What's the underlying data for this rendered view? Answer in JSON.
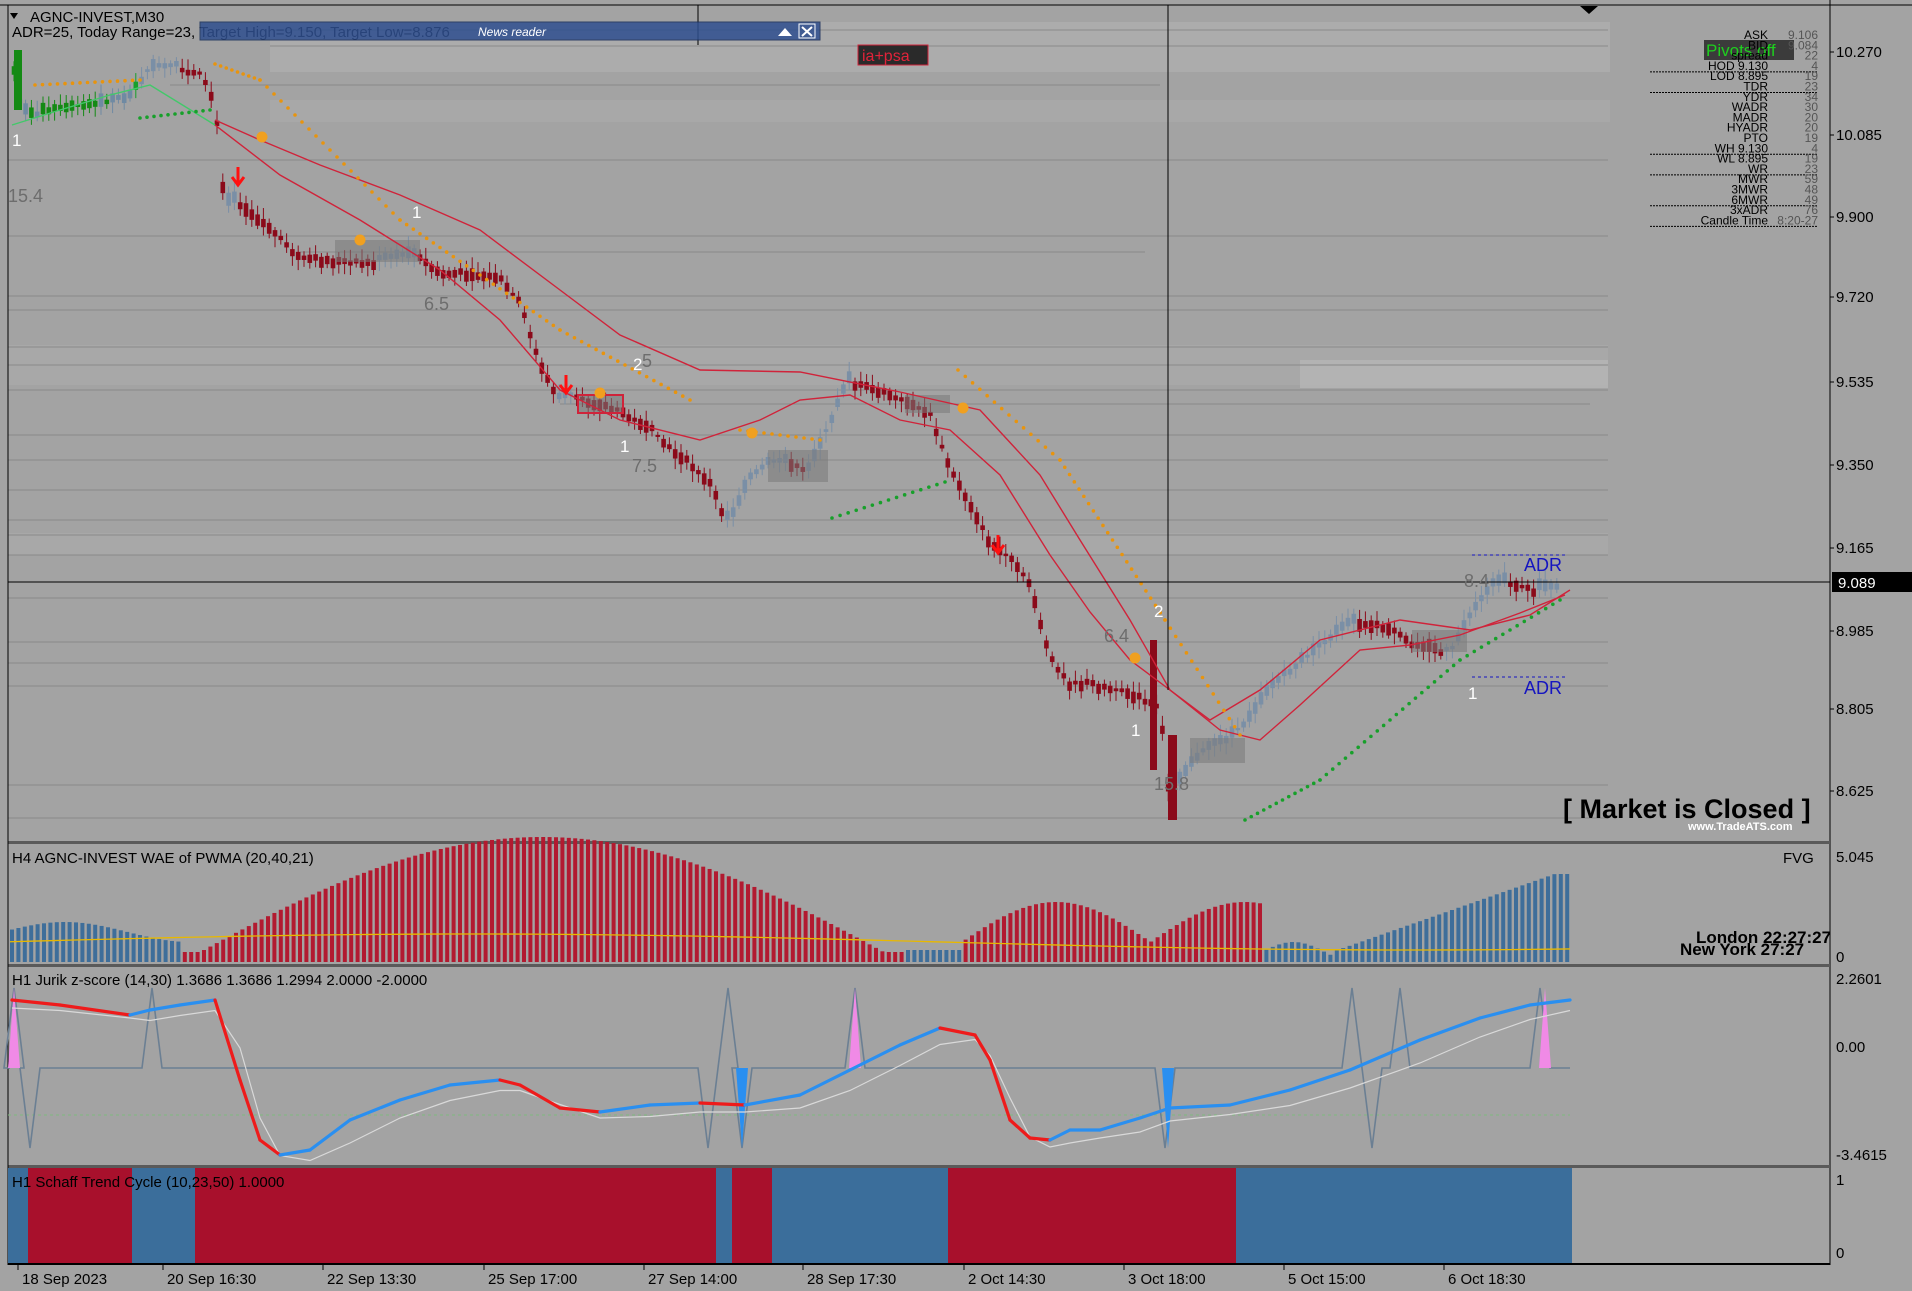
{
  "header": {
    "symbol": "AGNC-INVEST,M30",
    "adr_line": "ADR=25, Today Range=23, Target High=9.150, Target Low=8.876"
  },
  "news_reader": {
    "title": "News reader"
  },
  "badge": {
    "label": "ia+psa"
  },
  "market_closed": "[ Market is Closed ]",
  "watermark": "www.TradeATS.com",
  "current_price": "9.089",
  "price_axis": [
    "10.270",
    "10.085",
    "9.900",
    "9.720",
    "9.535",
    "9.350",
    "9.165",
    "8.985",
    "8.805",
    "8.625"
  ],
  "info_panel": {
    "pivot_label": "Pivots off",
    "rows": [
      {
        "label": "ASK",
        "value": "9.106"
      },
      {
        "label": "BID",
        "value": "9.084"
      },
      {
        "label": "spread",
        "value": "22"
      },
      {
        "label": "HOD 9.130",
        "value": "4"
      },
      {
        "label": "LOD 8.895",
        "value": "19"
      },
      {
        "label": "TDR",
        "value": "23"
      },
      {
        "label": "YDR",
        "value": "34"
      },
      {
        "label": "WADR",
        "value": "30"
      },
      {
        "label": "MADR",
        "value": "20"
      },
      {
        "label": "HYADR",
        "value": "20"
      },
      {
        "label": "PTO",
        "value": "19"
      },
      {
        "label": "WH 9.130",
        "value": "4"
      },
      {
        "label": "WL 8.895",
        "value": "19"
      },
      {
        "label": "WR",
        "value": "23"
      },
      {
        "label": "MWR",
        "value": "59"
      },
      {
        "label": "3MWR",
        "value": "48"
      },
      {
        "label": "6MWR",
        "value": "49"
      },
      {
        "label": "3xADR",
        "value": "76"
      },
      {
        "label": "Candle Time",
        "value": "8:20-27"
      }
    ]
  },
  "chart_labels": {
    "zz_1a": "1",
    "zz_15_4": "15.4",
    "zz_1b": "1",
    "zz_6_5": "6.5",
    "zz_2a": "2",
    "zz_5": "5",
    "zz_1c": "1",
    "zz_7_5": "7.5",
    "zz_6_4": "6.4",
    "zz_2b": "2",
    "zz_1d": "1",
    "zz_15_8": "15.8",
    "zz_1e": "1",
    "zz_8_4": "8.4",
    "adr_top": "ADR",
    "adr_bottom": "ADR"
  },
  "wae_panel": {
    "title": "H4 AGNC-INVEST WAE of PWMA (20,40,21)",
    "fvg": "FVG",
    "axis_top": "5.045",
    "axis_bottom": "0",
    "london": "London 22:27:27",
    "newyork": "New York 27:27"
  },
  "jurik_panel": {
    "title": "H1 Jurik z-score (14,30) 1.3686 1.3686 1.2994 2.0000 -2.0000",
    "axis_top": "2.2601",
    "axis_mid": "0.00",
    "axis_bottom": "-3.4615"
  },
  "schaff_panel": {
    "title": "H1 Schaff Trend Cycle (10,23,50) 1.0000",
    "axis_top": "1",
    "axis_bottom": "0"
  },
  "time_axis": [
    "18 Sep 2023",
    "20 Sep 16:30",
    "22 Sep 13:30",
    "25 Sep 17:00",
    "27 Sep 14:00",
    "28 Sep 17:30",
    "2 Oct 14:30",
    "3 Oct 18:00",
    "5 Oct 15:00",
    "6 Oct 18:30"
  ],
  "colors": {
    "background": "#a3a3a3",
    "bear_candle": "#8b0a1a",
    "bull_candle": "#7a8fa6",
    "ma_red": "#d0233a",
    "dots_orange": "#e8940e",
    "dots_green": "#17a02a",
    "bar_red": "#b21a30",
    "bar_blue": "#3e6e9a",
    "jurik_blue": "#2a8ff0",
    "jurik_red": "#ee1b1b",
    "schaff_red": "#a8102c",
    "schaff_blue": "#3b6e9b"
  },
  "chart_data": [
    {
      "type": "candlestick",
      "title": "AGNC-INVEST,M30",
      "x": [
        "18 Sep 2023",
        "20 Sep 16:30",
        "22 Sep 13:30",
        "25 Sep 17:00",
        "27 Sep 14:00",
        "28 Sep 17:30",
        "2 Oct 14:30",
        "3 Oct 18:00",
        "5 Oct 15:00",
        "6 Oct 18:30"
      ],
      "close": [
        10.15,
        10.15,
        9.83,
        9.47,
        9.37,
        9.5,
        9.2,
        8.65,
        8.95,
        9.089
      ],
      "ylim": [
        8.55,
        10.36
      ],
      "last_price": 9.089
    },
    {
      "type": "bar",
      "title": "H4 AGNC-INVEST WAE of PWMA (20,40,21)",
      "ylim": [
        0,
        5.045
      ],
      "series": [
        {
          "name": "bear",
          "values": [
            0.5,
            1.2,
            2.4,
            3.8,
            4.6,
            4.4,
            3.4,
            2.5,
            1.5,
            2.8,
            3.2,
            2.6,
            1.8
          ]
        },
        {
          "name": "bull",
          "values": [
            1.0,
            0.8,
            0.6,
            0.4,
            0.9,
            1.8,
            2.6,
            3.0,
            3.4
          ]
        }
      ]
    },
    {
      "type": "line",
      "title": "H1 Jurik z-score (14,30) 1.3686 1.3686 1.2994 2.0000 -2.0000",
      "ylim": [
        -3.4615,
        2.2601
      ],
      "series": [
        {
          "name": "z-score",
          "values": [
            1.4,
            0.9,
            1.3,
            -3.2,
            -2.0,
            -0.6,
            -1.5,
            -1.3,
            -1.0,
            0.2,
            -3.0,
            -2.3,
            -1.6,
            0.0,
            1.0,
            1.37
          ]
        }
      ]
    },
    {
      "type": "area",
      "title": "H1 Schaff Trend Cycle (10,23,50) 1.0000",
      "ylim": [
        0,
        1
      ],
      "series": [
        {
          "name": "stc",
          "values": [
            1,
            1,
            1,
            1,
            1,
            1,
            1,
            1,
            1,
            1
          ]
        }
      ]
    }
  ]
}
